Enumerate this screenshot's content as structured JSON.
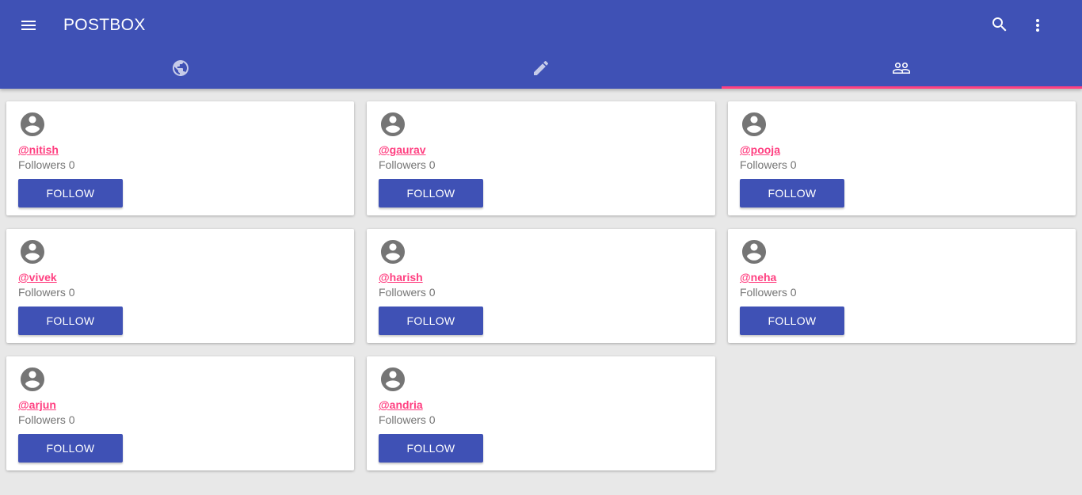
{
  "app": {
    "title": "POSTBOX",
    "accent_color": "#3f51b5",
    "indicator_color": "#ff4081",
    "icons": {
      "menu": "menu-icon",
      "search": "search-icon",
      "more": "more-vert-icon"
    }
  },
  "tabs": [
    {
      "icon": "globe-icon",
      "active": false
    },
    {
      "icon": "pencil-icon",
      "active": false
    },
    {
      "icon": "people-icon",
      "active": true
    }
  ],
  "users": [
    {
      "handle": "@nitish",
      "followers": "Followers 0",
      "button": "FOLLOW"
    },
    {
      "handle": "@gaurav",
      "followers": "Followers 0",
      "button": "FOLLOW"
    },
    {
      "handle": "@pooja",
      "followers": "Followers 0",
      "button": "FOLLOW"
    },
    {
      "handle": "@vivek",
      "followers": "Followers 0",
      "button": "FOLLOW"
    },
    {
      "handle": "@harish",
      "followers": "Followers 0",
      "button": "FOLLOW"
    },
    {
      "handle": "@neha",
      "followers": "Followers 0",
      "button": "FOLLOW"
    },
    {
      "handle": "@arjun",
      "followers": "Followers 0",
      "button": "FOLLOW"
    },
    {
      "handle": "@andria",
      "followers": "Followers 0",
      "button": "FOLLOW"
    }
  ]
}
